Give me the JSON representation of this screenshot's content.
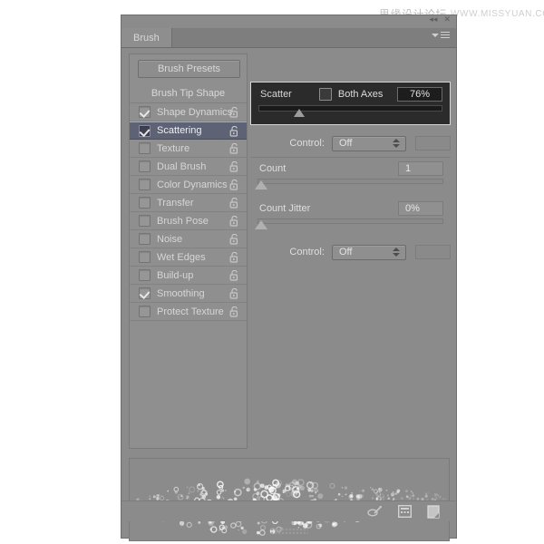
{
  "watermark": {
    "cn": "思缘设计论坛",
    "en": "WWW.MISSYUAN.COM"
  },
  "panel": {
    "tab_label": "Brush",
    "menu_icon": "panel-menu-icon",
    "collapse_icon": "collapse-to-icons-icon",
    "close_icon": "close-icon"
  },
  "left": {
    "presets_button": "Brush Presets",
    "tip_shape_label": "Brush Tip Shape",
    "options": [
      {
        "label": "Shape Dynamics",
        "checked": true,
        "selected": false,
        "lock": "unlocked"
      },
      {
        "label": "Scattering",
        "checked": true,
        "selected": true,
        "lock": "unlocked"
      },
      {
        "label": "Texture",
        "checked": false,
        "selected": false,
        "lock": "unlocked"
      },
      {
        "label": "Dual Brush",
        "checked": false,
        "selected": false,
        "lock": "unlocked"
      },
      {
        "label": "Color Dynamics",
        "checked": false,
        "selected": false,
        "lock": "unlocked"
      },
      {
        "label": "Transfer",
        "checked": false,
        "selected": false,
        "lock": "unlocked"
      },
      {
        "label": "Brush Pose",
        "checked": false,
        "selected": false,
        "lock": "unlocked"
      },
      {
        "label": "Noise",
        "checked": false,
        "selected": false,
        "lock": "unlocked"
      },
      {
        "label": "Wet Edges",
        "checked": false,
        "selected": false,
        "lock": "unlocked"
      },
      {
        "label": "Build-up",
        "checked": false,
        "selected": false,
        "lock": "unlocked"
      },
      {
        "label": "Smoothing",
        "checked": true,
        "selected": false,
        "lock": "unlocked"
      },
      {
        "label": "Protect Texture",
        "checked": false,
        "selected": false,
        "lock": "unlocked"
      }
    ]
  },
  "scatter": {
    "label": "Scatter",
    "both_axes_label": "Both Axes",
    "both_axes_checked": false,
    "value": "76%",
    "slider_percent": 22
  },
  "scatter_control": {
    "label": "Control:",
    "value": "Off"
  },
  "count": {
    "label": "Count",
    "value": "1",
    "slider_percent": 2
  },
  "count_jitter": {
    "label": "Count Jitter",
    "value": "0%",
    "slider_percent": 2
  },
  "count_control": {
    "label": "Control:",
    "value": "Off"
  },
  "footer": {
    "icons": [
      {
        "name": "create-new-brush-from-settings-icon"
      },
      {
        "name": "toggle-brush-panel-icon"
      },
      {
        "name": "new-brush-icon"
      }
    ],
    "resize_grip": "resize-grip"
  },
  "preview": {
    "alt": "brush-stroke-preview"
  },
  "colors": {
    "panel_bg": "#8b8b8b",
    "highlight_row": "#5d6275",
    "scatter_block_bg": "#2b2b2b",
    "text": "#d8d8d8"
  }
}
